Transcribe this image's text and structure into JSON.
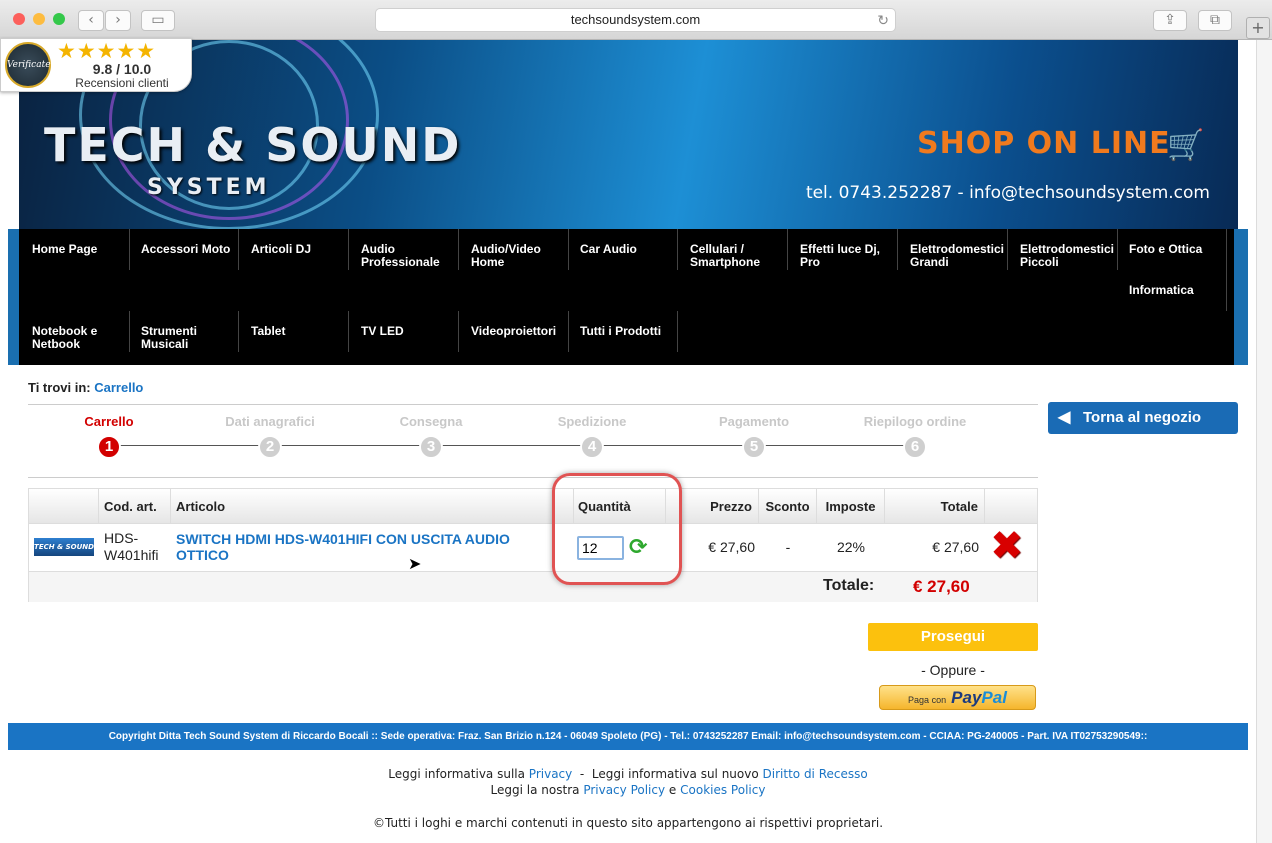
{
  "browser": {
    "url": "techsoundsystem.com",
    "back_icon": "chevron-left-icon",
    "forward_icon": "chevron-right-icon",
    "traffic_colors": [
      "#fc605c",
      "#fdbc40",
      "#34c84a"
    ]
  },
  "badge": {
    "seal_text": "Verificate",
    "stars": "★★★★★",
    "score": "9.8 / 10.0",
    "label": "Recensioni clienti"
  },
  "header": {
    "logo_main": "TECH & SOUND",
    "logo_sub": "SYSTEM",
    "shop_label": "SHOP ON LINE",
    "contact": "tel. 0743.252287 - info@techsoundsystem.com"
  },
  "nav": {
    "row1": [
      "Home Page",
      "Accessori Moto",
      "Articoli DJ",
      "Audio Professionale",
      "Audio/Video Home",
      "Car Audio",
      "Cellulari / Smartphone",
      "Effetti luce Dj, Pro",
      "Elettrodomestici Grandi",
      "Elettrodomestici Piccoli",
      "Foto e Ottica"
    ],
    "row1b": "Informatica",
    "row2": [
      "Notebook e Netbook",
      "Strumenti Musicali",
      "Tablet",
      "TV LED",
      "Videoproiettori",
      "Tutti i Prodotti"
    ]
  },
  "breadcrumb": {
    "prefix": "Ti trovi in:",
    "current": "Carrello"
  },
  "steps": [
    {
      "label": "Carrello",
      "num": "1"
    },
    {
      "label": "Dati anagrafici",
      "num": "2"
    },
    {
      "label": "Consegna",
      "num": "3"
    },
    {
      "label": "Spedizione",
      "num": "4"
    },
    {
      "label": "Pagamento",
      "num": "5"
    },
    {
      "label": "Riepilogo ordine",
      "num": "6"
    }
  ],
  "back_button": "Torna al negozio",
  "cart": {
    "headers": {
      "code": "Cod. art.",
      "article": "Articolo",
      "qty": "Quantità",
      "price": "Prezzo",
      "discount": "Sconto",
      "tax": "Imposte",
      "total": "Totale"
    },
    "row": {
      "thumb": "TECH & SOUND",
      "code": "HDS-W401hifi",
      "name": "SWITCH HDMI HDS-W401HIFI CON USCITA AUDIO OTTICO",
      "qty": "12",
      "price": "€ 27,60",
      "discount": "-",
      "tax": "22%",
      "total": "€ 27,60"
    },
    "total_label": "Totale:",
    "total_value": "€ 27,60"
  },
  "actions": {
    "continue": "Prosegui",
    "or": "- Oppure -",
    "paypal_small": "Paga con",
    "paypal_a": "Pay",
    "paypal_b": "Pal"
  },
  "footer": {
    "copyright_bar": "Copyright Ditta Tech Sound System di Riccardo Bocali :: Sede operativa: Fraz. San Brizio n.124 - 06049 Spoleto (PG) - Tel.: 0743252287 Email: info@techsoundsystem.com - CCIAA: PG-240005 - Part. IVA IT02753290549::",
    "line1_a": "Leggi informativa sulla",
    "line1_link1": "Privacy",
    "line1_sep": "-",
    "line1_b": "Leggi informativa sul nuovo",
    "line1_link2": "Diritto di Recesso",
    "line2_a": "Leggi la nostra",
    "line2_link1": "Privacy Policy",
    "line2_and": "e",
    "line2_link2": "Cookies Policy",
    "line3": "©Tutti i loghi e marchi contenuti in questo sito appartengono ai rispettivi proprietari."
  }
}
